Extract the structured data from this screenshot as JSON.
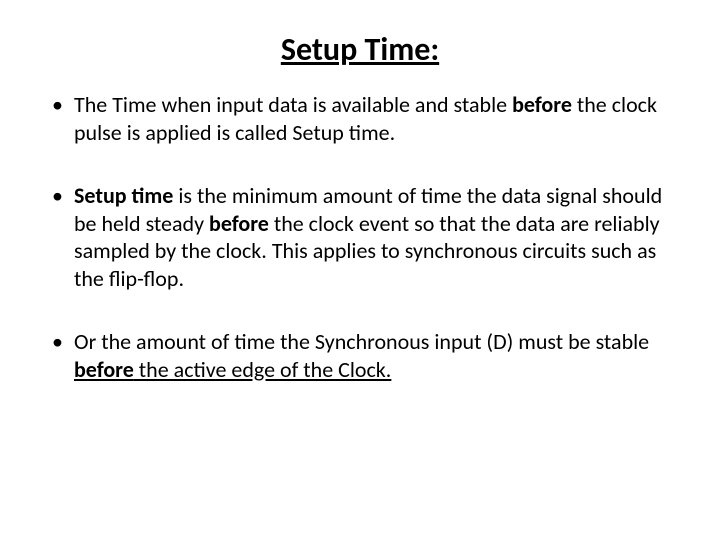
{
  "title": "Setup Time:",
  "bullets": [
    {
      "t1": "The Time when input data is available and stable ",
      "b1": "before ",
      "t2": "the clock pulse is applied is called Setup time."
    },
    {
      "b1": "Setup time ",
      "t1": "is the minimum amount of time the data signal should be held steady ",
      "b2": "before ",
      "t2": "the clock event so that the data are reliably sampled by the clock. This applies to synchronous circuits such as the flip-flop."
    },
    {
      "t1": "Or   the amount of time the Synchronous input (D) must be stable ",
      "bu1": "before",
      "u1": " the active edge of the Clock."
    }
  ]
}
